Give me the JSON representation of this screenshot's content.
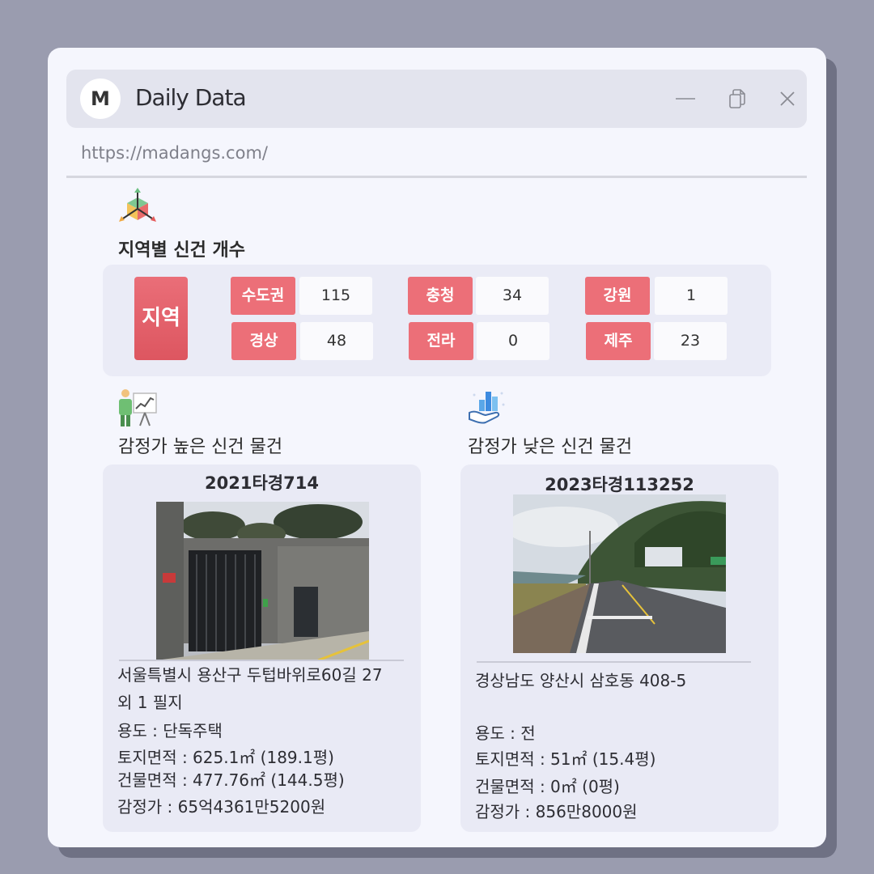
{
  "app": {
    "logo_letter": "M",
    "title": "Daily Data",
    "url": "https://madangs.com/"
  },
  "regions": {
    "title": "지역별 신건 개수",
    "header_label": "지역",
    "items": [
      {
        "name": "수도권",
        "count": "115"
      },
      {
        "name": "충청",
        "count": "34"
      },
      {
        "name": "강원",
        "count": "1"
      },
      {
        "name": "경상",
        "count": "48"
      },
      {
        "name": "전라",
        "count": "0"
      },
      {
        "name": "제주",
        "count": "23"
      }
    ]
  },
  "high": {
    "title": "감정가 높은 신건 물건",
    "case_no": "2021타경714",
    "address_line1": "서울특별시 용산구 두텁바위로60길 27",
    "address_line2": "외 1 필지",
    "usage": "용도 : 단독주택",
    "land_area": "토지면적 : 625.1㎡ (189.1평)",
    "building_area": "건물면적 : 477.76㎡ (144.5평)",
    "appraisal": "감정가 : 65억4361만5200원"
  },
  "low": {
    "title": "감정가 낮은 신건 물건",
    "case_no": "2023타경113252",
    "address_line1": "경상남도 양산시 삼호동 408-5",
    "usage": "용도 : 전",
    "land_area": "토지면적 : 51㎡ (15.4평)",
    "building_area": "건물면적 : 0㎡ (0평)",
    "appraisal": "감정가 : 856만8000원"
  },
  "colors": {
    "accent_red": "#ec6f78",
    "background": "#9a9caf",
    "window": "#f5f6fd",
    "panel": "#e9eaf5"
  },
  "icons": {
    "region": "cube-axes-icon",
    "high": "presentation-chart-icon",
    "low": "hand-bar-chart-icon"
  }
}
